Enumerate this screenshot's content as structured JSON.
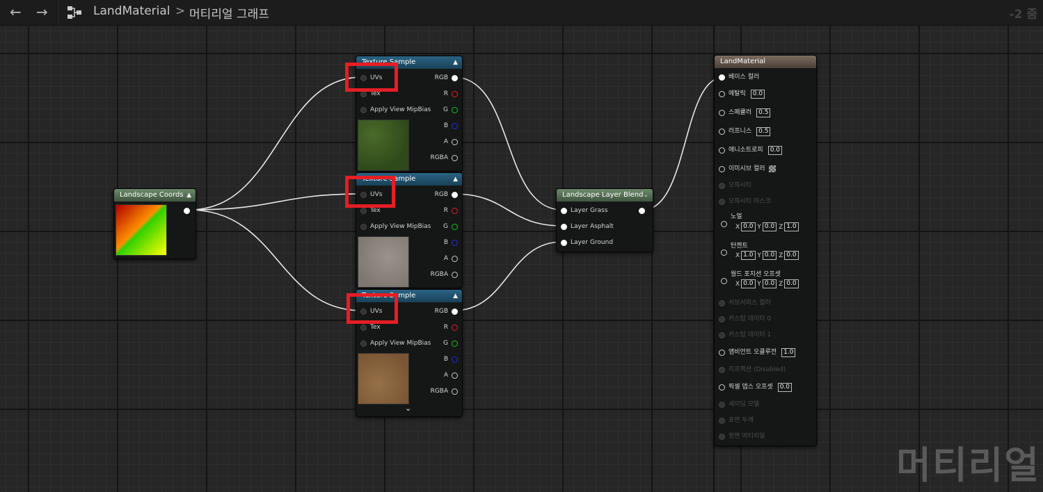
{
  "header": {
    "back_icon": "←",
    "forward_icon": "→",
    "breadcrumb_root": "LandMaterial",
    "breadcrumb_sep": ">",
    "breadcrumb_current": "머티리얼 그래프",
    "zoom": "-2 줌"
  },
  "nodes": {
    "landscape_coords": {
      "title": "Landscape Coords"
    },
    "texture_samples": [
      {
        "title": "Texture Sample",
        "inputs": [
          "UVs",
          "Tex",
          "Apply View MipBias"
        ],
        "outputs": [
          "RGB",
          "R",
          "G",
          "B",
          "A",
          "RGBA"
        ]
      },
      {
        "title": "Texture Sample",
        "inputs": [
          "UVs",
          "Tex",
          "Apply View MipBias"
        ],
        "outputs": [
          "RGB",
          "R",
          "G",
          "B",
          "A",
          "RGBA"
        ]
      },
      {
        "title": "Texture Sample",
        "inputs": [
          "UVs",
          "Tex",
          "Apply View MipBias"
        ],
        "outputs": [
          "RGB",
          "R",
          "G",
          "B",
          "A",
          "RGBA"
        ]
      }
    ],
    "layer_blend": {
      "title": "Landscape Layer Blend",
      "inputs": [
        "Layer Grass",
        "Layer Asphalt",
        "Layer Ground"
      ]
    },
    "land_material": {
      "title": "LandMaterial",
      "pins": [
        {
          "label": "베이스 컬러",
          "active": true
        },
        {
          "label": "메탈릭",
          "active": true,
          "value": "0.0"
        },
        {
          "label": "스페큘러",
          "active": true,
          "value": "0.5"
        },
        {
          "label": "러프니스",
          "active": true,
          "value": "0.5"
        },
        {
          "label": "애니소트로피",
          "active": true,
          "value": "0.0"
        },
        {
          "label": "이미시브 컬러",
          "active": true
        },
        {
          "label": "오파시티",
          "active": false
        },
        {
          "label": "오파시티 마스크",
          "active": false
        },
        {
          "label": "노멀",
          "active": true,
          "x": "0.0",
          "y": "0.0",
          "z": "1.0"
        },
        {
          "label": "탄젠트",
          "active": true,
          "x": "1.0",
          "y": "0.0",
          "z": "0.0"
        },
        {
          "label": "월드 포지션 오프셋",
          "active": true,
          "x": "0.0",
          "y": "0.0",
          "z": "0.0"
        },
        {
          "label": "서브서피스 컬러",
          "active": false
        },
        {
          "label": "커스텀 데이터 0",
          "active": false
        },
        {
          "label": "커스텀 데이터 1",
          "active": false
        },
        {
          "label": "앰비언트 오클루전",
          "active": true,
          "value": "1.0"
        },
        {
          "label": "리프랙션 (Disabled)",
          "active": false
        },
        {
          "label": "픽셀 뎁스 오프셋",
          "active": true,
          "value": "0.0"
        },
        {
          "label": "셰이딩 모델",
          "active": false
        },
        {
          "label": "표면 두께",
          "active": false
        },
        {
          "label": "정면 머티리얼",
          "active": false
        }
      ]
    }
  },
  "axis_labels": {
    "x": "X",
    "y": "Y",
    "z": "Z"
  },
  "colors": {
    "grass_swatch": "#3a5a22",
    "asphalt_swatch": "#8d8680",
    "ground_swatch": "#86603a",
    "highlight": "#e51e25",
    "pin_r": "#e02020",
    "pin_g": "#20c020",
    "pin_b": "#2030e0"
  },
  "watermark": "머티리얼"
}
